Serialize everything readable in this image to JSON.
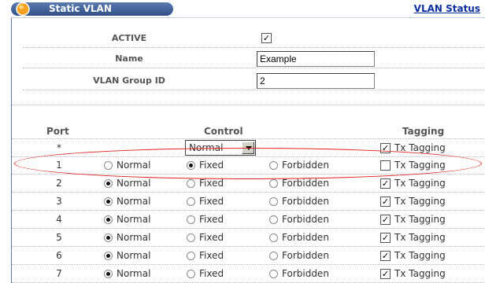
{
  "header": {
    "title": "Static VLAN",
    "status_link": "VLAN Status"
  },
  "form": {
    "active_label": "ACTIVE",
    "active_checked": true,
    "name_label": "Name",
    "name_value": "Example",
    "group_label": "VLAN Group ID",
    "group_value": "2"
  },
  "table": {
    "col_port": "Port",
    "col_control": "Control",
    "col_tagging": "Tagging",
    "opt_normal": "Normal",
    "opt_fixed": "Fixed",
    "opt_forbidden": "Forbidden",
    "tx_label": "Tx Tagging",
    "all_row": {
      "port": "*",
      "select_value": "Normal",
      "tagged": true
    },
    "rows": [
      {
        "port": "1",
        "control": "Fixed",
        "tagged": false,
        "highlighted": true
      },
      {
        "port": "2",
        "control": "Normal",
        "tagged": true
      },
      {
        "port": "3",
        "control": "Normal",
        "tagged": true
      },
      {
        "port": "4",
        "control": "Normal",
        "tagged": true
      },
      {
        "port": "5",
        "control": "Normal",
        "tagged": true
      },
      {
        "port": "6",
        "control": "Normal",
        "tagged": true
      },
      {
        "port": "7",
        "control": "Normal",
        "tagged": true
      }
    ]
  },
  "colors": {
    "title_bar": "#2f4f86",
    "link": "#0b2f9e",
    "highlight": "#e02020"
  }
}
